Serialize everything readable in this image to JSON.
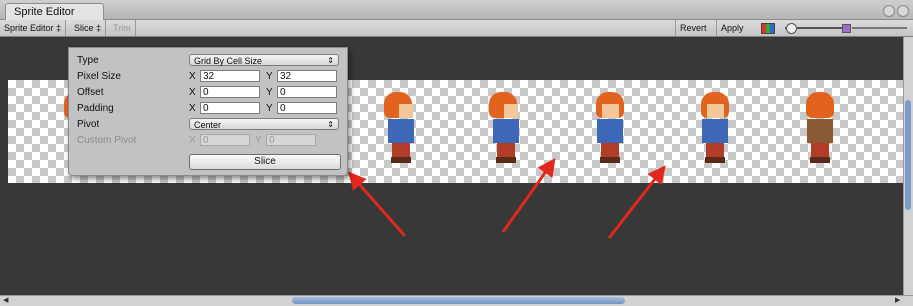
{
  "window": {
    "tab_title": "Sprite Editor"
  },
  "toolbar": {
    "sprite_editor_menu": "Sprite Editor ‡",
    "slice_menu": "Slice ‡",
    "trim_label": "Trim",
    "revert_label": "Revert",
    "apply_label": "Apply"
  },
  "slice_panel": {
    "type_label": "Type",
    "type_value": "Grid By Cell Size",
    "pixel_size_label": "Pixel Size",
    "pixel_size_x": "32",
    "pixel_size_y": "32",
    "offset_label": "Offset",
    "offset_x": "0",
    "offset_y": "0",
    "padding_label": "Padding",
    "padding_x": "0",
    "padding_y": "0",
    "pivot_label": "Pivot",
    "pivot_value": "Center",
    "custom_pivot_label": "Custom Pivot",
    "custom_pivot_x": "0",
    "custom_pivot_y": "0",
    "slice_button": "Slice",
    "x_axis": "X",
    "y_axis": "Y"
  },
  "annotations": {
    "arrow_color": "#e0281d",
    "arrow_count": 4
  }
}
